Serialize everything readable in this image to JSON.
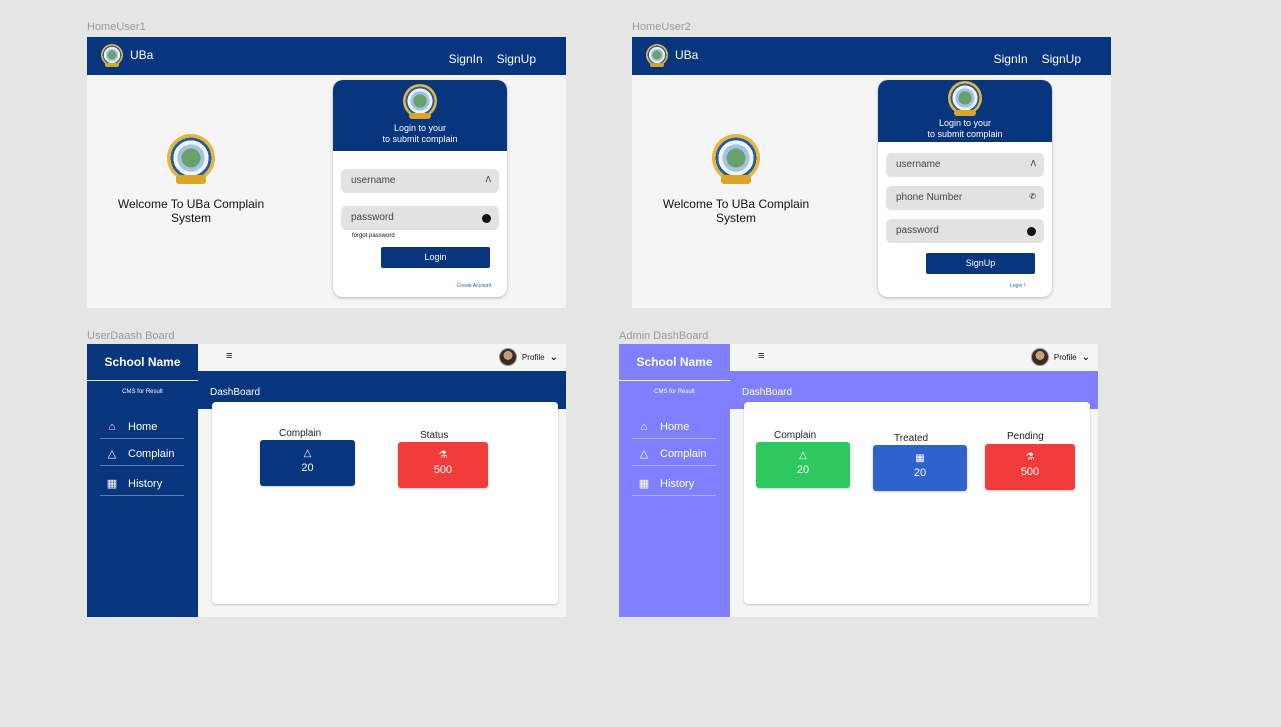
{
  "frames": {
    "home1": "HomeUser1",
    "home2": "HomeUser2",
    "user_dash": "UserDaash Board",
    "admin_dash": "Admin DashBoard"
  },
  "colors": {
    "primary": "#07367f",
    "admin_side": "#7f7fff",
    "green": "#2ec861",
    "red": "#f23c3c",
    "blue": "#2f62cc"
  },
  "topbar": {
    "brand": "UBa",
    "signin": "SignIn",
    "signup": "SignUp"
  },
  "welcome": {
    "line1": "Welcome To UBa   Complain",
    "line2": "System"
  },
  "login_card": {
    "head1": "Login to your",
    "head2": "to submit complain",
    "username_placeholder": "username",
    "password_placeholder": "password",
    "forgot": "forgot password",
    "button": "Login",
    "create": "Create Account"
  },
  "signup_card": {
    "head1": "Login to your",
    "head2": "to submit complain",
    "username_placeholder": "username",
    "phone_placeholder": "phone Number",
    "password_placeholder": "password",
    "button": "SignUp",
    "login_link": "Login !"
  },
  "sidebar": {
    "title": "School Name",
    "subtitle": "CMS for Result",
    "items": [
      {
        "label": "Home",
        "icon": "home-icon"
      },
      {
        "label": "Complain",
        "icon": "complain-icon"
      },
      {
        "label": "History",
        "icon": "history-icon"
      }
    ]
  },
  "dash": {
    "profile": "Profile",
    "title": "DashBoard"
  },
  "user_stats": [
    {
      "label": "Complain",
      "value": "20"
    },
    {
      "label": "Status",
      "value": "500"
    }
  ],
  "admin_stats": [
    {
      "label": "Complain",
      "value": "20"
    },
    {
      "label": "Treated",
      "value": "20"
    },
    {
      "label": "Pending",
      "value": "500"
    }
  ]
}
